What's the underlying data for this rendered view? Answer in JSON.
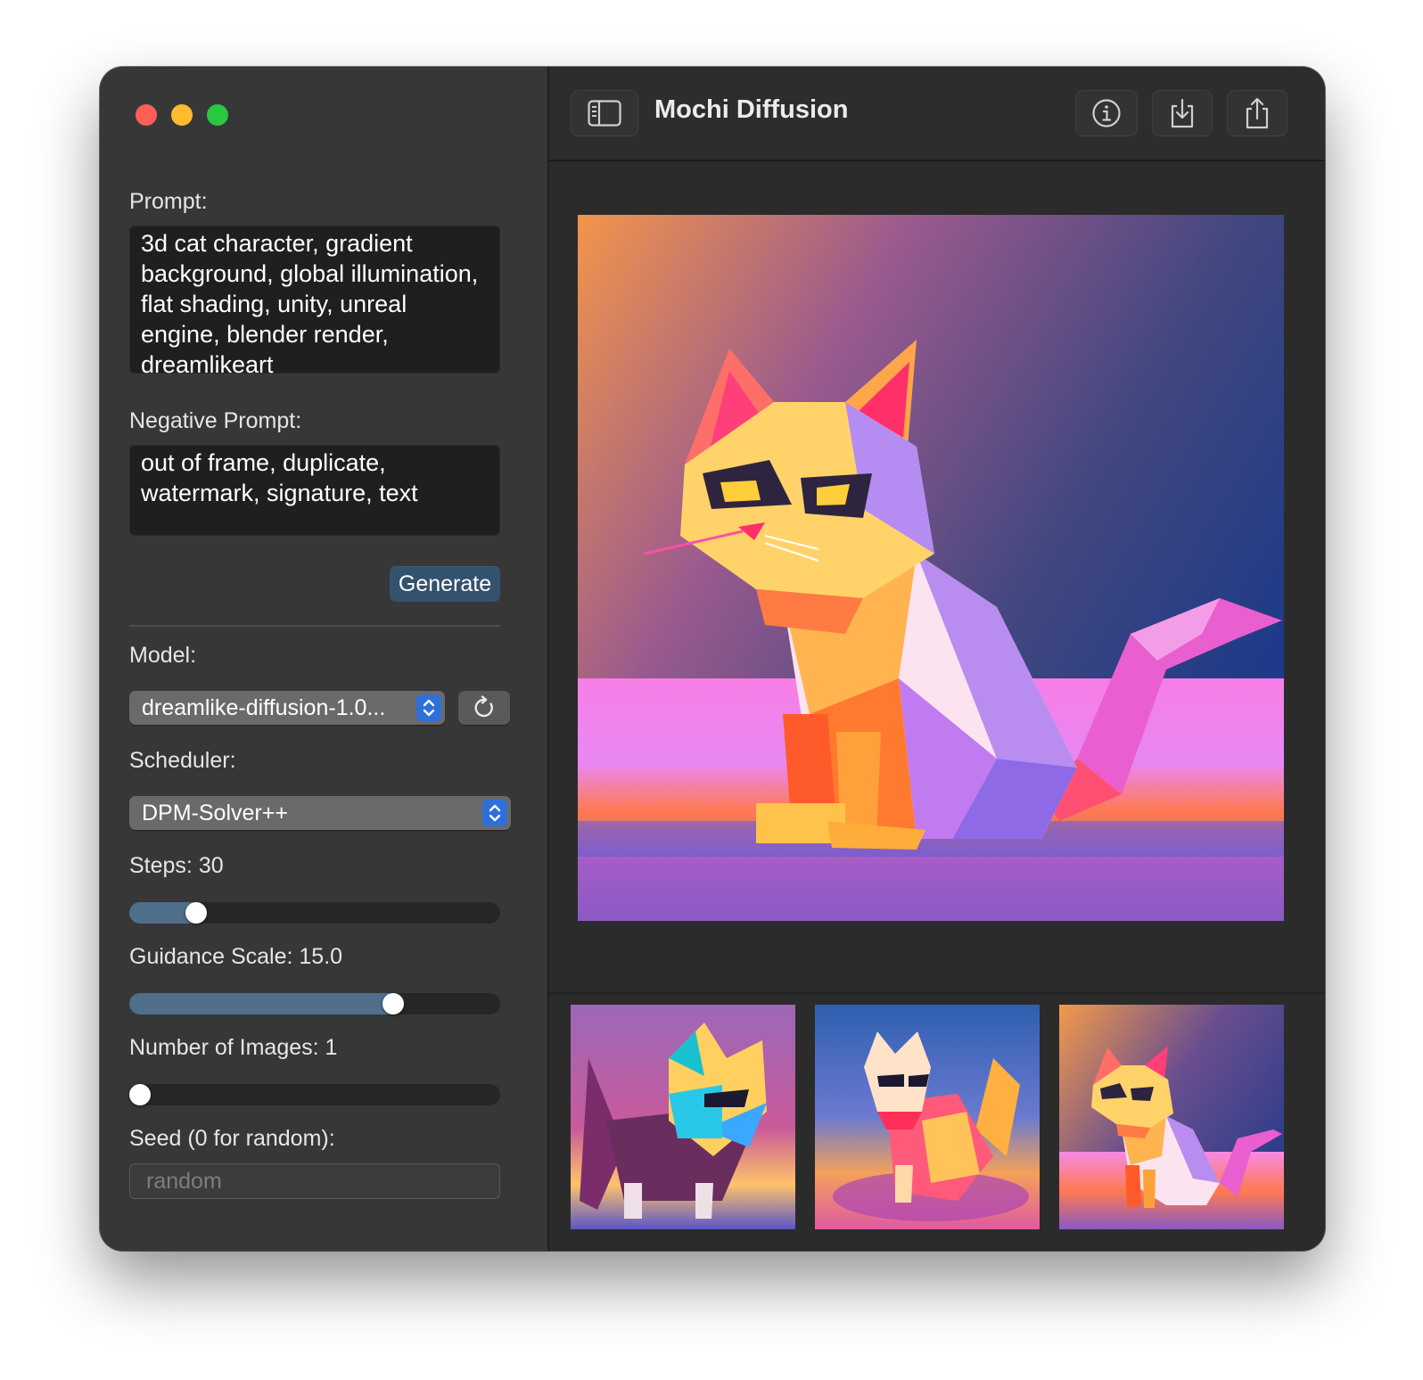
{
  "window": {
    "title": "Mochi Diffusion"
  },
  "sidebar": {
    "prompt_label": "Prompt:",
    "prompt_value": "3d cat character, gradient background, global illumination, flat shading, unity, unreal engine, blender render, dreamlikeart",
    "negative_prompt_label": "Negative Prompt:",
    "negative_prompt_value": "out of frame, duplicate, watermark, signature, text",
    "generate_label": "Generate",
    "model_label": "Model:",
    "model_value": "dreamlike-diffusion-1.0...",
    "scheduler_label": "Scheduler:",
    "scheduler_value": "DPM-Solver++",
    "steps_label": "Steps: 30",
    "steps_fraction": 0.16,
    "guidance_label": "Guidance Scale: 15.0",
    "guidance_fraction": 0.725,
    "images_label": "Number of Images: 1",
    "images_fraction": 0.0,
    "seed_label": "Seed (0 for random):",
    "seed_placeholder": "random"
  },
  "toolbar": {
    "sidebar_toggle_icon": "sidebar-left-icon",
    "info_icon": "info-circle-icon",
    "save_icon": "download-tray-icon",
    "share_icon": "share-icon"
  },
  "colors": {
    "accent": "#2f6fd9",
    "generate_button": "#33526e",
    "slider_fill": "#4f6f8b"
  }
}
